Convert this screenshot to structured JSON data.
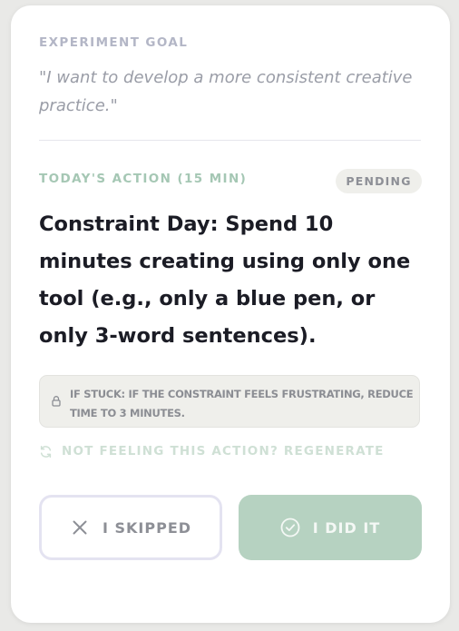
{
  "goal": {
    "label": "EXPERIMENT GOAL",
    "text": "\"I want to develop a more consistent creative practice.\""
  },
  "action": {
    "label": "TODAY'S ACTION (15 MIN)",
    "status": "PENDING",
    "text": "Constraint Day: Spend 10 minutes creating using only one tool (e.g., only a blue pen, or only 3-word sentences)."
  },
  "stuck": {
    "icon": "lock-icon",
    "text": "IF STUCK: IF THE CONSTRAINT FEELS FRUSTRATING, REDUCE TIME TO 3 MINUTES."
  },
  "regenerate": {
    "icon": "refresh-icon",
    "label": "NOT FEELING THIS ACTION? REGENERATE"
  },
  "buttons": {
    "skip": {
      "icon": "close-icon",
      "label": "I SKIPPED"
    },
    "done": {
      "icon": "check-circle-icon",
      "label": "I DID IT"
    }
  },
  "colors": {
    "accent_green": "#b6d2c1",
    "label_green": "#a5c7b4",
    "muted_text": "#9a9da7",
    "heading_text": "#1b1c25",
    "card_bg": "#ffffff",
    "page_bg": "#e9e9e7"
  }
}
